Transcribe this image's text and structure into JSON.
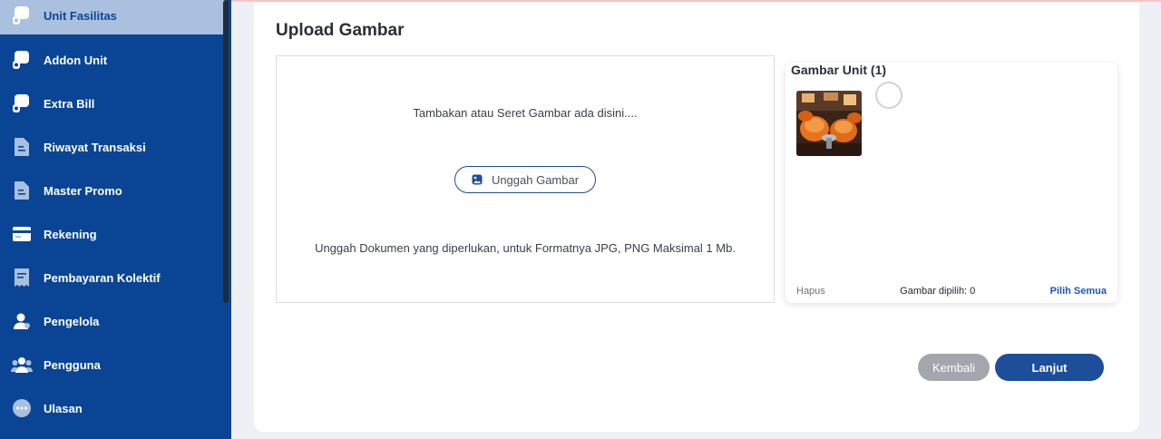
{
  "sidebar": {
    "items": [
      {
        "label": "Unit Fasilitas",
        "icon": "building-icon",
        "active": true
      },
      {
        "label": "Addon Unit",
        "icon": "building-icon"
      },
      {
        "label": "Extra Bill",
        "icon": "building-icon"
      },
      {
        "label": "Riwayat Transaksi",
        "icon": "document-icon"
      },
      {
        "label": "Master Promo",
        "icon": "document-icon"
      },
      {
        "label": "Rekening",
        "icon": "card-icon"
      },
      {
        "label": "Pembayaran Kolektif",
        "icon": "receipt-icon"
      },
      {
        "label": "Pengelola",
        "icon": "user-icon"
      },
      {
        "label": "Pengguna",
        "icon": "users-icon"
      },
      {
        "label": "Ulasan",
        "icon": "chat-icon"
      }
    ]
  },
  "page": {
    "title": "Upload Gambar"
  },
  "dropzone": {
    "hint": "Tambakan atau Seret Gambar ada disini....",
    "button_label": "Unggah Gambar",
    "note": "Unggah Dokumen yang diperlukan, untuk Formatnya JPG, PNG Maksimal 1 Mb."
  },
  "gallery": {
    "title": "Gambar Unit (1)",
    "delete_label": "Hapus",
    "selected_count": "Gambar dipilih: 0",
    "select_all_label": "Pilih Semua"
  },
  "actions": {
    "back_label": "Kembali",
    "next_label": "Lanjut"
  },
  "colors": {
    "sidebar": "#0a4595",
    "sidebar_active": "#a9c0df",
    "primary_button": "#1d4e9a",
    "secondary_button": "#a3a6ad",
    "link": "#1a56c4"
  }
}
